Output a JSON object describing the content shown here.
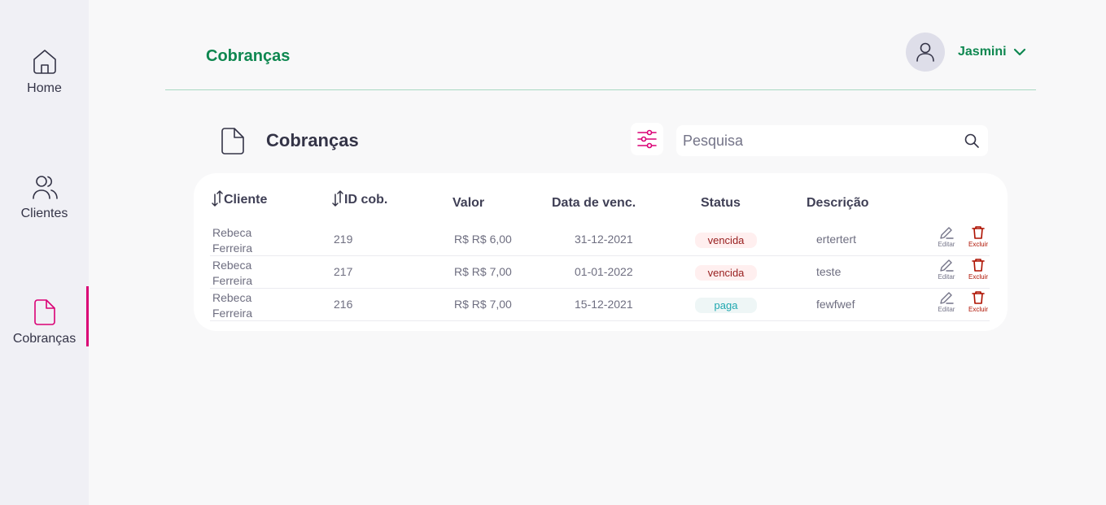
{
  "sidebar": {
    "items": [
      {
        "label": "Home",
        "icon": "home-icon",
        "active": false
      },
      {
        "label": "Clientes",
        "icon": "users-icon",
        "active": false
      },
      {
        "label": "Cobranças",
        "icon": "document-icon",
        "active": true
      }
    ],
    "active_color": "#da0175"
  },
  "header": {
    "title": "Cobranças",
    "user_name": "Jasmini",
    "accent_color": "#0e8750"
  },
  "main": {
    "section_title": "Cobranças",
    "search": {
      "placeholder": "Pesquisa",
      "value": ""
    },
    "table": {
      "columns": [
        "Cliente",
        "ID cob.",
        "Valor",
        "Data de venc.",
        "Status",
        "Descrição"
      ],
      "rows": [
        {
          "cliente": "Rebeca Ferreira",
          "id": "219",
          "valor": "R$ R$ 6,00",
          "data": "31-12-2021",
          "status": "vencida",
          "descricao": "ertertert"
        },
        {
          "cliente": "Rebeca Ferreira",
          "id": "217",
          "valor": "R$ R$ 7,00",
          "data": "01-01-2022",
          "status": "vencida",
          "descricao": "teste"
        },
        {
          "cliente": "Rebeca Ferreira",
          "id": "216",
          "valor": "R$ R$ 7,00",
          "data": "15-12-2021",
          "status": "paga",
          "descricao": "fewfwef"
        }
      ],
      "actions": {
        "edit_label": "Editar",
        "delete_label": "Excluir"
      }
    }
  }
}
